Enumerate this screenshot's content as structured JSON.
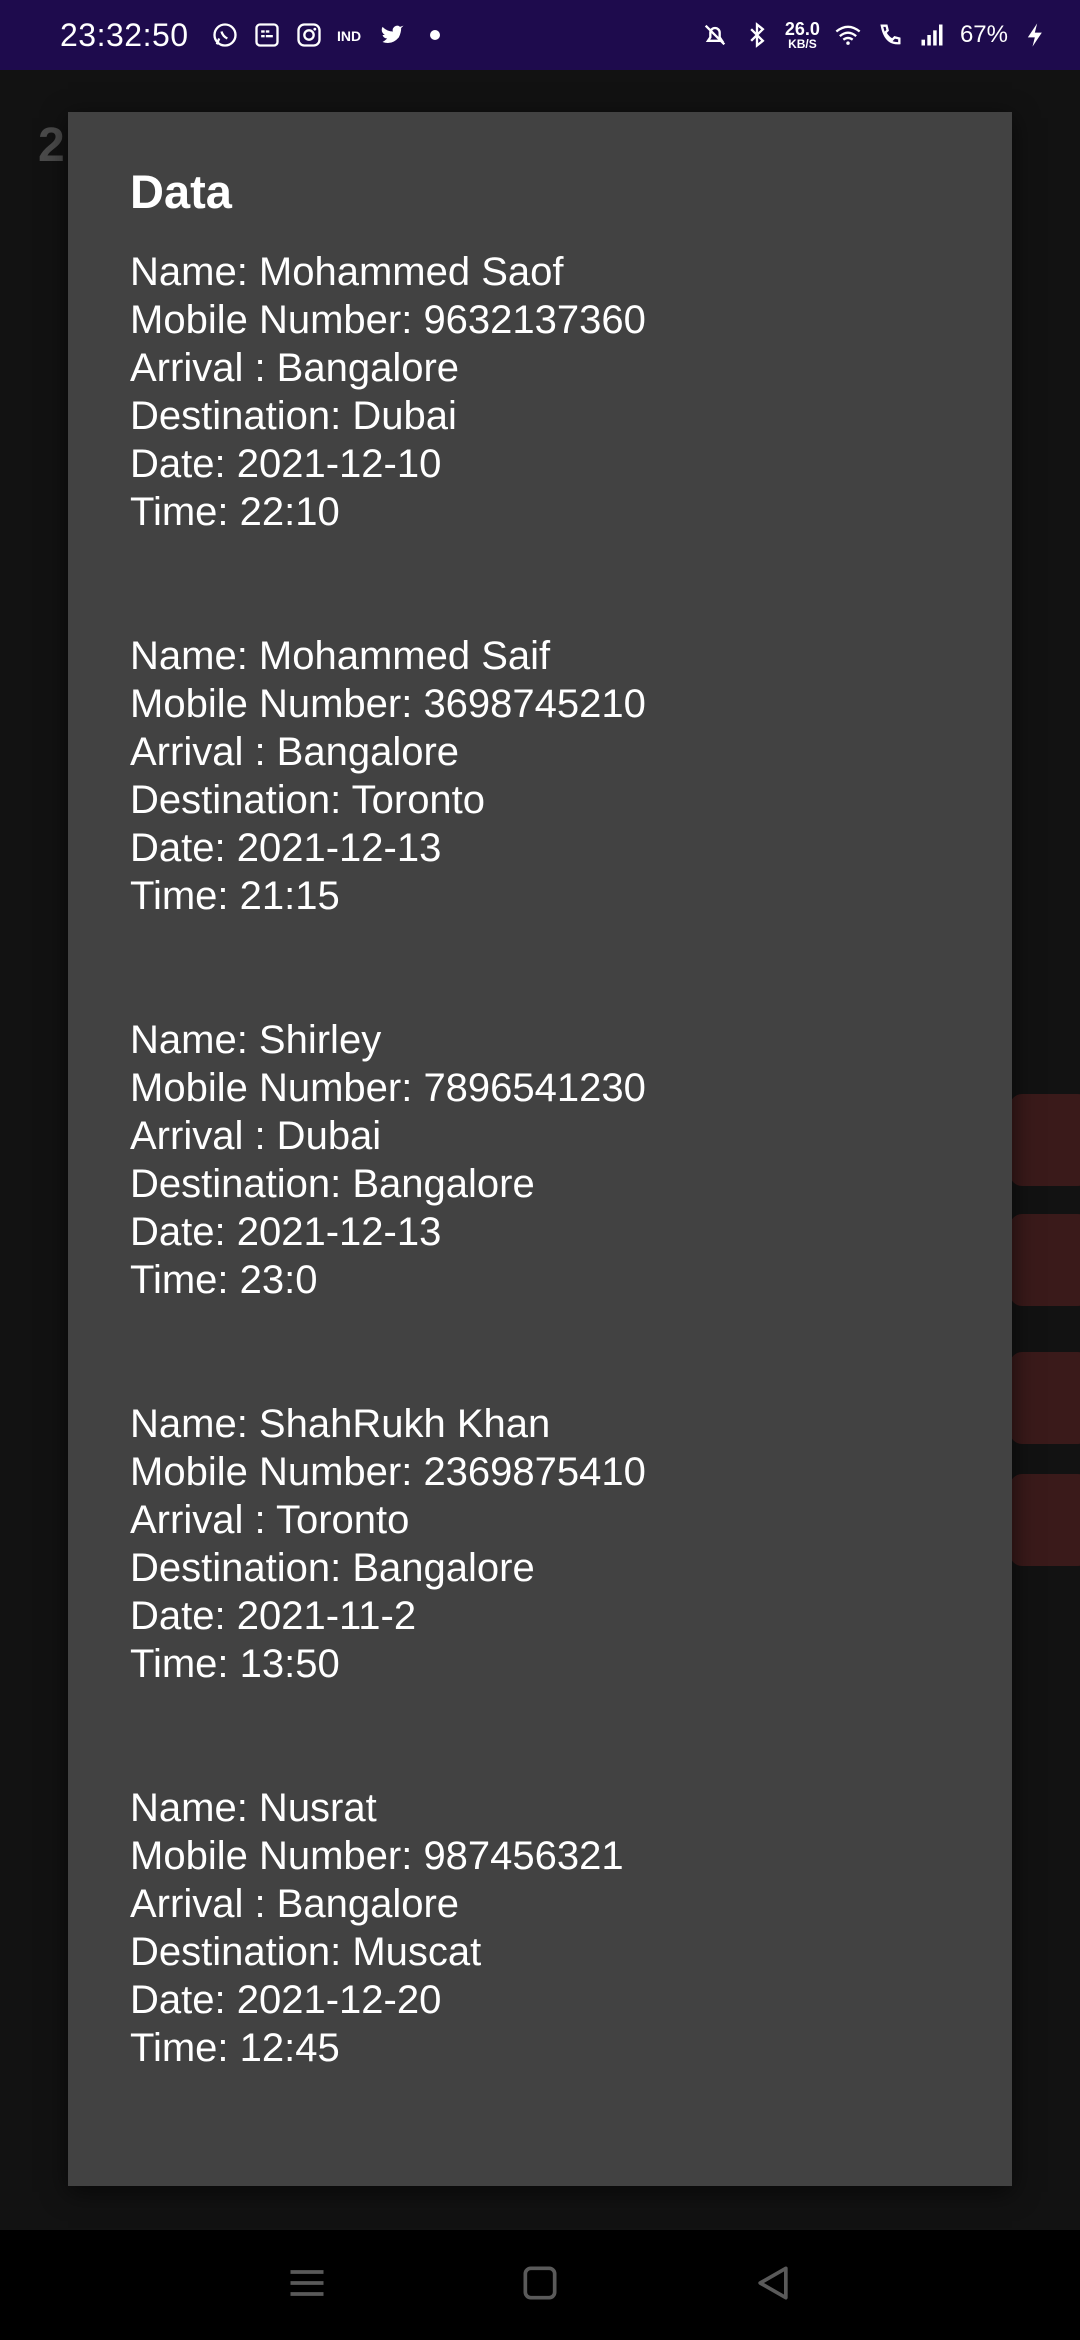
{
  "status_bar": {
    "time": "23:32:50",
    "netspeed_value": "26.0",
    "netspeed_unit": "KB/S",
    "battery": "67%",
    "left_icons": [
      "whatsapp-icon",
      "messages-icon",
      "instagram-icon",
      "indigo-icon",
      "twitter-icon",
      "dot-icon"
    ],
    "right_icons": [
      "mute-bell-icon",
      "bluetooth-icon",
      "wifi-icon",
      "wifi-call-icon",
      "signal-icon",
      "charging-icon"
    ]
  },
  "background": {
    "heading_fragment": "2"
  },
  "dialog": {
    "title": "Data",
    "records": [
      {
        "name": "Name: Mohammed Saof",
        "mobile": "Mobile Number: 9632137360",
        "arrival": "Arrival : Bangalore",
        "destination": "Destination: Dubai",
        "date": "Date: 2021-12-10",
        "time": "Time: 22:10"
      },
      {
        "name": "Name: Mohammed Saif",
        "mobile": "Mobile Number: 3698745210",
        "arrival": "Arrival : Bangalore",
        "destination": "Destination: Toronto",
        "date": "Date: 2021-12-13",
        "time": "Time: 21:15"
      },
      {
        "name": "Name: Shirley",
        "mobile": "Mobile Number: 7896541230",
        "arrival": "Arrival : Dubai",
        "destination": "Destination: Bangalore",
        "date": "Date: 2021-12-13",
        "time": "Time: 23:0"
      },
      {
        "name": "Name: ShahRukh Khan",
        "mobile": "Mobile Number: 2369875410",
        "arrival": "Arrival : Toronto",
        "destination": "Destination: Bangalore",
        "date": "Date: 2021-11-2",
        "time": "Time: 13:50"
      },
      {
        "name": "Name: Nusrat",
        "mobile": "Mobile Number: 987456321",
        "arrival": "Arrival : Bangalore",
        "destination": "Destination: Muscat",
        "date": "Date: 2021-12-20",
        "time": "Time: 12:45"
      }
    ]
  },
  "nav_bar": {
    "icons": [
      "menu-icon",
      "home-icon",
      "back-icon"
    ]
  }
}
